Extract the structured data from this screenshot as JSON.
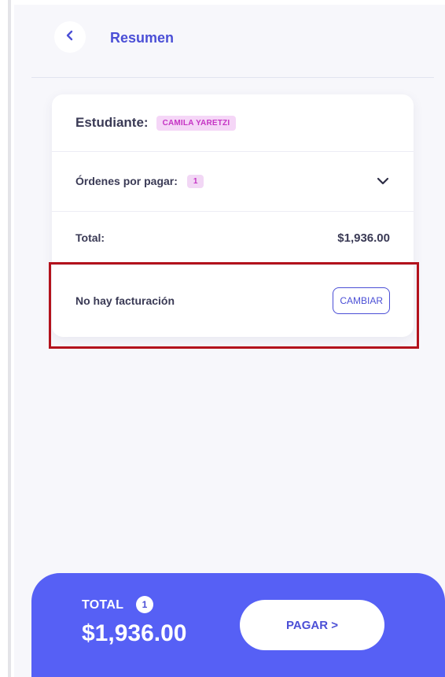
{
  "header": {
    "title": "Resumen"
  },
  "summary": {
    "student_label": "Estudiante:",
    "student_name": "CAMILA YARETZI",
    "orders_label": "Órdenes por pagar:",
    "orders_count": "1",
    "total_label": "Total:",
    "total_amount": "$1,936.00",
    "billing_label": "No hay facturación",
    "change_button": "CAMBIAR"
  },
  "footer": {
    "total_label": "TOTAL",
    "count": "1",
    "amount": "$1,936.00",
    "pay_button": "PAGAR >"
  },
  "icons": {
    "back": "chevron-left-icon",
    "orders_toggle": "chevron-down-icon"
  },
  "colors": {
    "primary": "#4b4fd6",
    "footer_bg": "#5660f5",
    "badge_bg": "#f5d6f7",
    "badge_text": "#c534c4",
    "highlight": "#b3121c"
  }
}
